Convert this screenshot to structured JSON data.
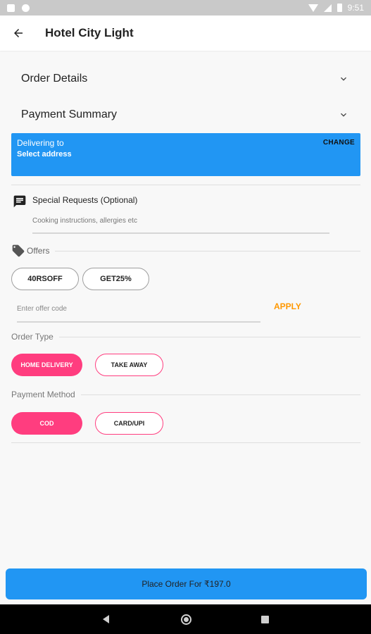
{
  "status_bar": {
    "time": "9:51"
  },
  "app_bar": {
    "title": "Hotel City Light"
  },
  "sections": {
    "order_details": "Order Details",
    "payment_summary": "Payment Summary"
  },
  "delivery": {
    "title": "Delivering to",
    "address": "Select address",
    "change_label": "CHANGE"
  },
  "special_requests": {
    "label": "Special Requests (Optional)",
    "placeholder": "Cooking instructions, allergies etc",
    "value": ""
  },
  "offers": {
    "label": "Offers",
    "chips": [
      "40RSOFF",
      "GET25%"
    ],
    "code_placeholder": "Enter offer code",
    "apply_label": "APPLY"
  },
  "order_type": {
    "label": "Order Type",
    "options": [
      "HOME DELIVERY",
      "TAKE AWAY"
    ],
    "selected": "HOME DELIVERY"
  },
  "payment_method": {
    "label": "Payment Method",
    "options": [
      "COD",
      "CARD/UPI"
    ],
    "selected": "COD"
  },
  "place_order": {
    "label": "Place Order For ₹197.0"
  },
  "colors": {
    "primary": "#2196f3",
    "accent": "#ff3d7f",
    "apply": "#ff9800"
  },
  "icons": {
    "back": "arrow-back-icon",
    "chevron": "chevron-down-icon",
    "message": "message-icon",
    "tag": "tag-icon"
  }
}
